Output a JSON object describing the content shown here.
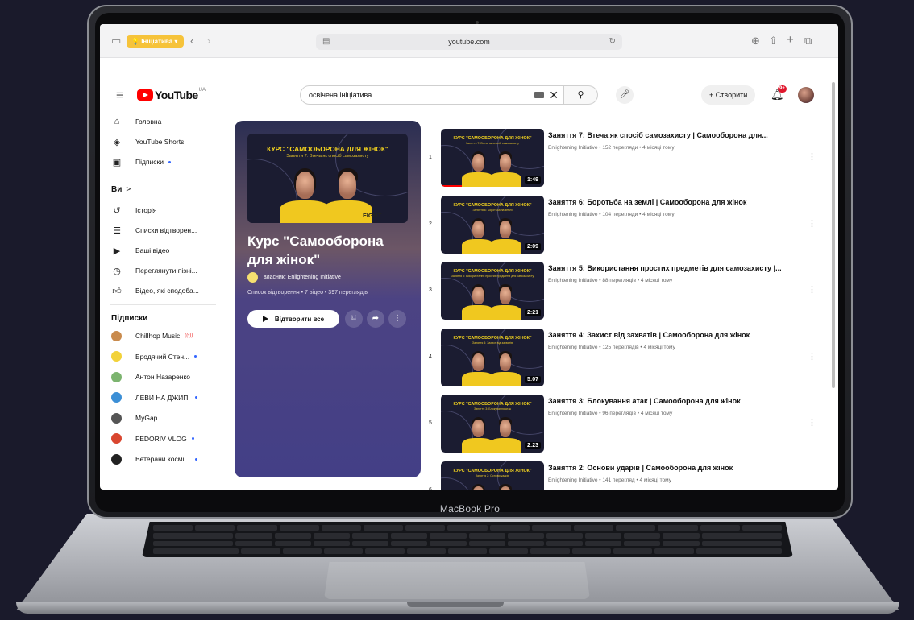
{
  "device": {
    "model_label": "MacBook Pro"
  },
  "browser": {
    "tab_group_label": "Ініціатива",
    "url": "youtube.com"
  },
  "youtube": {
    "logo_word": "YouTube",
    "region": "UA",
    "search": {
      "query": "освічена ініціатива"
    },
    "create_label": "Створити",
    "notification_badge": "9+"
  },
  "sidebar": {
    "main": [
      {
        "icon": "home-icon",
        "label": "Головна"
      },
      {
        "icon": "shorts-icon",
        "label": "YouTube Shorts"
      },
      {
        "icon": "subscriptions-icon",
        "label": "Підписки",
        "dot": true
      }
    ],
    "you_header": "Ви",
    "you_chevron": ">",
    "you": [
      {
        "icon": "history-icon",
        "label": "Історія"
      },
      {
        "icon": "playlists-icon",
        "label": "Списки відтворен..."
      },
      {
        "icon": "your-videos-icon",
        "label": "Ваші відео"
      },
      {
        "icon": "watch-later-icon",
        "label": "Переглянути пізні..."
      },
      {
        "icon": "liked-videos-icon",
        "label": "Відео, які сподоба..."
      }
    ],
    "subs_header": "Підписки",
    "subscriptions": [
      {
        "label": "Chillhop Music",
        "live": "((•))",
        "color": "#c98b4d"
      },
      {
        "label": "Бродячий Стен...",
        "dot": true,
        "color": "#f2d23a"
      },
      {
        "label": "Антон Назаренко",
        "color": "#7cb46f"
      },
      {
        "label": "ЛЕВИ НА ДЖИПІ",
        "dot": true,
        "color": "#3c8fd6"
      },
      {
        "label": "MyGap",
        "color": "#555555"
      },
      {
        "label": "FEDORIV VLOG",
        "dot": true,
        "color": "#d9462f"
      },
      {
        "label": "Ветерани космі...",
        "dot": true,
        "color": "#222222"
      }
    ]
  },
  "playlist": {
    "title": "Курс \"Самооборона для жінок\"",
    "owner": "власник: Enlightening Initiative",
    "meta": "Список відтворення • 7 відео • 397 переглядів",
    "play_all_label": "Відтворити все",
    "thumb_headline": "КУРС \"САМООБОРОНА ДЛЯ ЖІНОК\"",
    "thumb_sub": "Заняття 7: Втеча як спосіб самозахисту",
    "thumb_shirt_text": "FIGHT"
  },
  "videos": [
    {
      "index": "1",
      "title": "Заняття 7: Втеча як спосіб самозахисту | Самооборона для...",
      "meta": "Enlightening Initiative • 152 перегляди • 4 місяці тому",
      "duration": "1:49",
      "thumb_sub": "Заняття 7: Втеча як спосіб самозахисту",
      "watched": 0.2
    },
    {
      "index": "2",
      "title": "Заняття 6: Боротьба на землі | Самооборона для жінок",
      "meta": "Enlightening Initiative • 104 перегляди • 4 місяці тому",
      "duration": "2:09",
      "thumb_sub": "Заняття 6: Боротьба на землі"
    },
    {
      "index": "3",
      "title": "Заняття 5: Використання простих предметів для самозахисту |...",
      "meta": "Enlightening Initiative • 88 переглядів • 4 місяці тому",
      "duration": "2:21",
      "thumb_sub": "Заняття 5: Використання простих предметів для самозахисту"
    },
    {
      "index": "4",
      "title": "Заняття 4: Захист від захватів | Самооборона для жінок",
      "meta": "Enlightening Initiative • 125 переглядів • 4 місяці тому",
      "duration": "5:07",
      "thumb_sub": "Заняття 4: Захист від захватів"
    },
    {
      "index": "5",
      "title": "Заняття 3: Блокування атак | Самооборона для жінок",
      "meta": "Enlightening Initiative • 96 переглядів • 4 місяці тому",
      "duration": "2:23",
      "thumb_sub": "Заняття 3: Блокування атак"
    },
    {
      "index": "6",
      "title": "Заняття 2: Основи ударів | Самооборона для жінок",
      "meta": "Enlightening Initiative • 141 перегляд • 4 місяці тому",
      "duration": "",
      "thumb_sub": "Заняття 2: Основи ударів"
    }
  ],
  "thumb_headline": "КУРС \"САМООБОРОНА ДЛЯ ЖІНОК\"",
  "colors": {
    "accent": "#ff0000",
    "playlist_bg": "#433f86",
    "thumb_yellow": "#f2d21f"
  }
}
